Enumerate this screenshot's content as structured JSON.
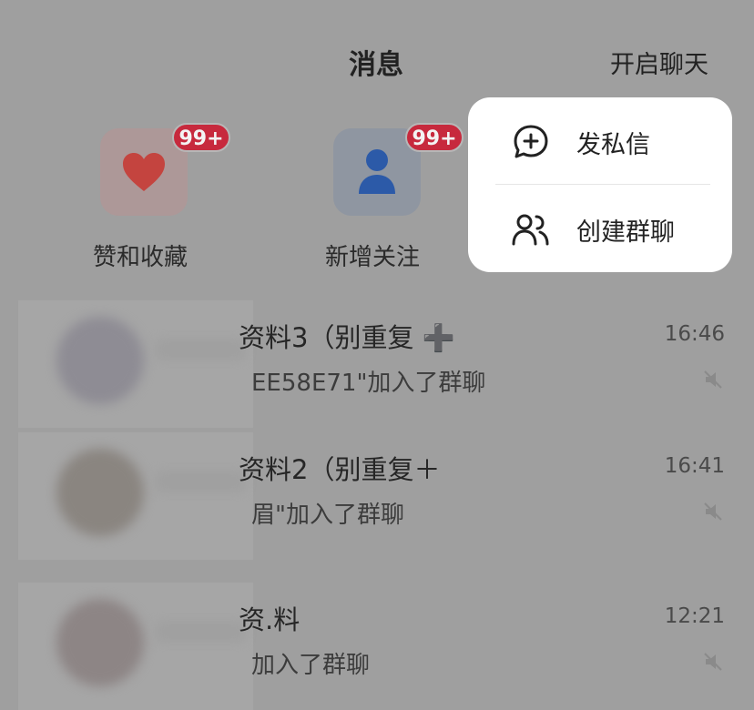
{
  "header": {
    "title": "消息",
    "start_chat": "开启聊天"
  },
  "quick_entries": {
    "likes": {
      "label": "赞和收藏",
      "badge": "99+",
      "icon": "heart-icon"
    },
    "follow": {
      "label": "新增关注",
      "badge": "99+",
      "icon": "person-icon"
    }
  },
  "popup": {
    "items": [
      {
        "label": "发私信",
        "icon": "chat-plus-icon"
      },
      {
        "label": "创建群聊",
        "icon": "group-icon"
      }
    ]
  },
  "conversations": [
    {
      "name": "资料3（别重复 ➕",
      "message": "EE58E71\"加入了群聊",
      "time": "16:46"
    },
    {
      "name": "资料2（别重复＋",
      "message": "眉\"加入了群聊",
      "time": "16:41"
    },
    {
      "name": "资.料",
      "message": "加入了群聊",
      "time": "12:21"
    }
  ],
  "colors": {
    "badge": "#c7293d",
    "heart": "#c4443f",
    "person": "#2c5aa8",
    "popup_bg": "#ffffff"
  }
}
